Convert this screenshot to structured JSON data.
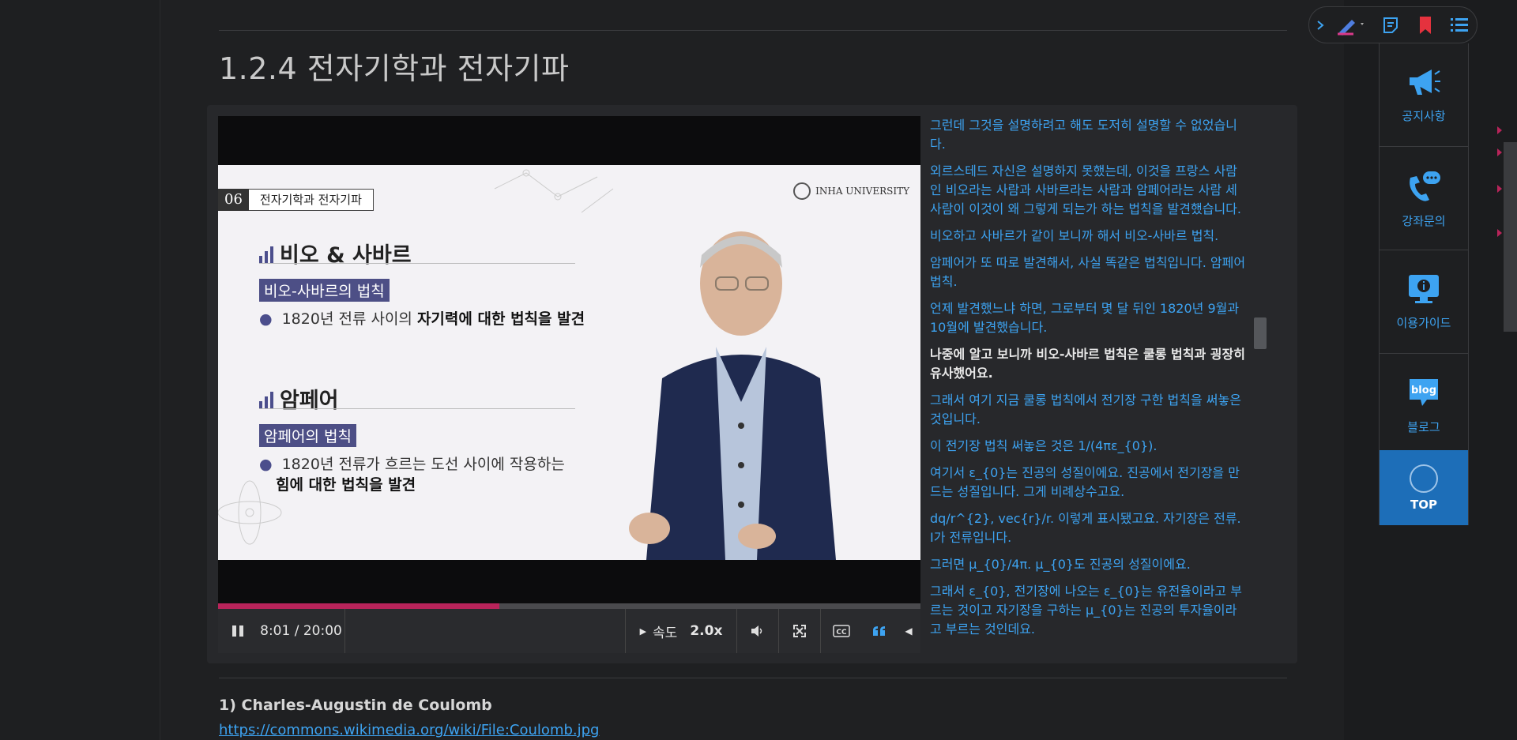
{
  "section_title": "1.2.4 전자기학과 전자기파",
  "slide": {
    "number": "06",
    "chapter": "전자기학과 전자기파",
    "logo_text": "INHA UNIVERSITY",
    "heading1": "비오 & 사바르",
    "pill1": "비오-사바르의 법칙",
    "bullet1_pre": "1820년 전류 사이의 ",
    "bullet1_bold": "자기력에 대한 법칙을 발견",
    "heading2": "암페어",
    "pill2": "암페어의 법칙",
    "bullet2_line1": "1820년 전류가 흐르는 도선 사이에 작용하는",
    "bullet2_bold": "힘에 대한 법칙을 발견"
  },
  "player": {
    "time": "8:01 / 20:00",
    "progress": 0.4005,
    "speed_label": "속도",
    "speed_value": "2.0x"
  },
  "transcript": [
    {
      "text": "그런데 그것을 설명하려고 해도 도저히 설명할 수 없었습니다.",
      "current": false
    },
    {
      "text": "외르스테드 자신은 설명하지 못했는데, 이것을 프랑스 사람인 비오라는 사람과 사바르라는 사람과 암페어라는 사람 세 사람이 이것이 왜 그렇게 되는가 하는 법칙을 발견했습니다.",
      "current": false
    },
    {
      "text": "비오하고 사바르가 같이 보니까 해서 비오-사바르 법칙.",
      "current": false
    },
    {
      "text": "암페어가 또 따로 발견해서, 사실 똑같은 법칙입니다. 암페어 법칙.",
      "current": false
    },
    {
      "text": "언제 발견했느냐 하면, 그로부터 몇 달 뒤인 1820년 9월과 10월에 발견했습니다.",
      "current": false
    },
    {
      "text": "나중에 알고 보니까 비오-사바르 법칙은 쿨롱 법칙과 굉장히 유사했어요.",
      "current": true
    },
    {
      "text": "그래서 여기 지금 쿨롱 법칙에서 전기장 구한 법칙을 써놓은 것입니다.",
      "current": false
    },
    {
      "text": "이 전기장 법칙 써놓은 것은 1/(4πε_{0}).",
      "current": false
    },
    {
      "text": "여기서 ε_{0}는 진공의 성질이에요. 진공에서 전기장을 만드는 성질입니다. 그게 비례상수고요.",
      "current": false
    },
    {
      "text": "dq/r^{2}, vec{r}/r. 이렇게 표시됐고요. 자기장은 전류. I가 전류입니다.",
      "current": false
    },
    {
      "text": "그러면 μ_{0}/4π. μ_{0}도 진공의 성질이에요.",
      "current": false
    },
    {
      "text": "그래서 ε_{0}, 전기장에 나오는 ε_{0}는 유전율이라고 부르는 것이고 자기장을 구하는 μ_{0}는 진공의 투자율이라고 부르는 것인데요.",
      "current": false
    }
  ],
  "reference": {
    "title": "1) Charles-Augustin de Coulomb",
    "link": "https://commons.wikimedia.org/wiki/File:Coulomb.jpg"
  },
  "side_menu": {
    "notice": "공지사항",
    "inquiry": "강좌문의",
    "guide": "이용가이드",
    "blog": "블로그",
    "blog_icon_text": "blog",
    "top": "TOP"
  },
  "colors": {
    "accent_blue": "#3da3f1",
    "progress_red": "#b8245a",
    "top_button": "#1d6eb8"
  },
  "icons": [
    "chevron-right-icon",
    "pen-icon",
    "note-icon",
    "bookmark-icon",
    "list-icon",
    "megaphone-icon",
    "phone-chat-icon",
    "monitor-info-icon",
    "blog-icon",
    "pause-icon",
    "volume-icon",
    "fullscreen-icon",
    "cc-icon",
    "quote-icon"
  ]
}
